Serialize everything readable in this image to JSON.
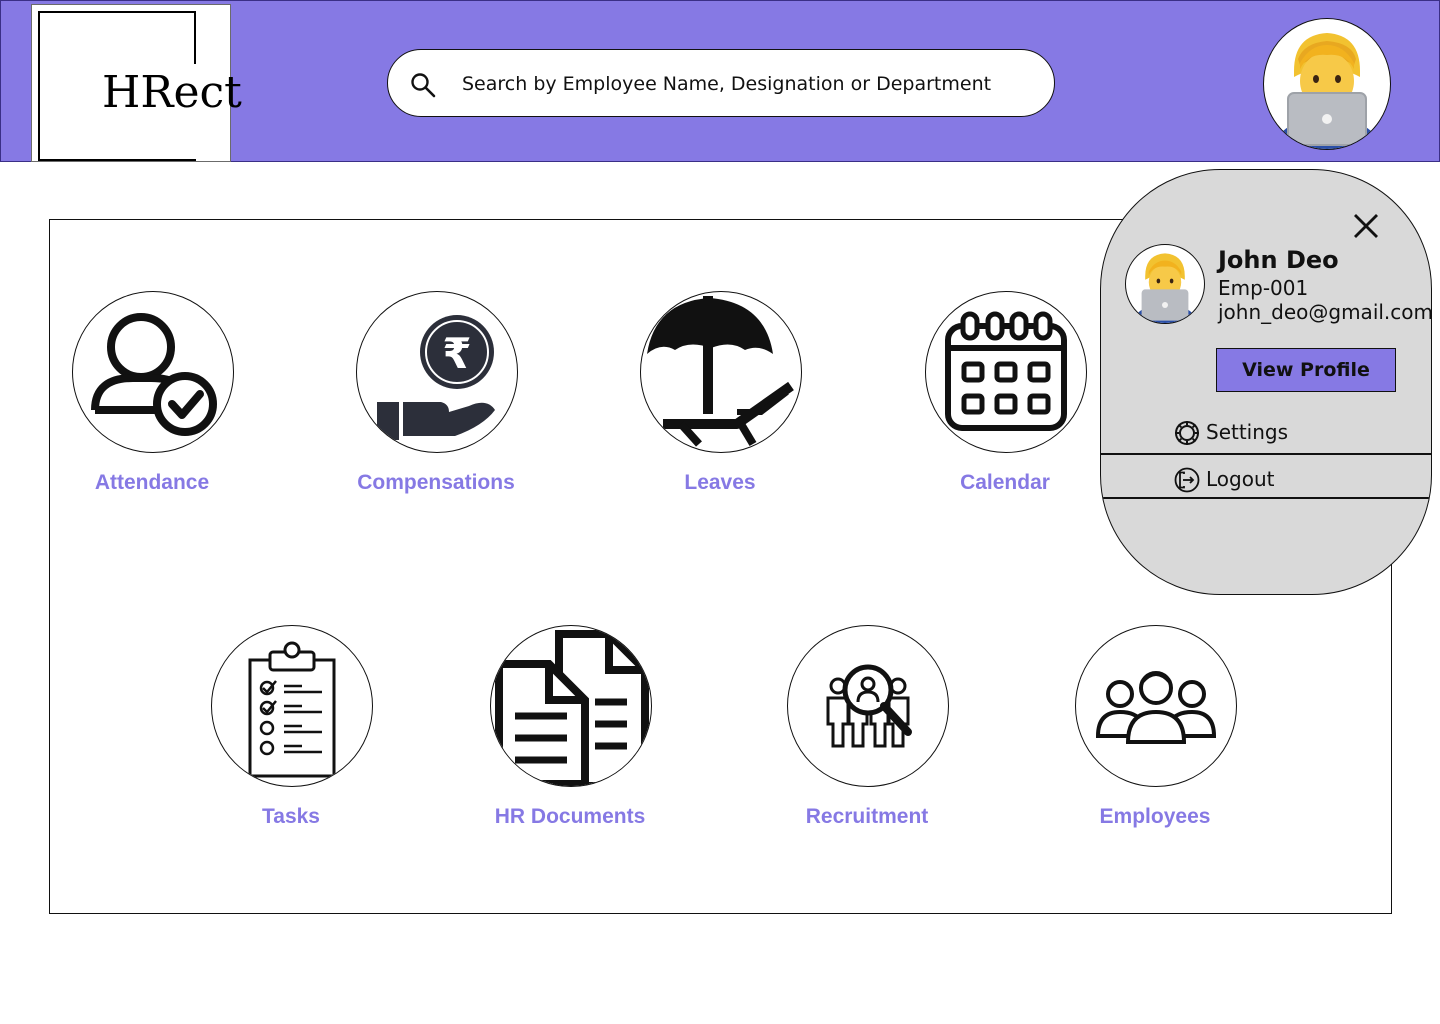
{
  "header": {
    "logo_text": "HRect",
    "search": {
      "placeholder": "Search by Employee Name, Designation or Department",
      "value": ""
    },
    "avatar_icon": "man-technologist-emoji"
  },
  "tiles": [
    {
      "label": "Attendance",
      "icon": "person-check-icon"
    },
    {
      "label": "Compensations",
      "icon": "rupee-hand-icon"
    },
    {
      "label": "Leaves",
      "icon": "beach-umbrella-icon"
    },
    {
      "label": "Calendar",
      "icon": "calendar-icon"
    },
    {
      "label": "Tasks",
      "icon": "checklist-clipboard-icon"
    },
    {
      "label": "HR Documents",
      "icon": "documents-icon"
    },
    {
      "label": "Recruitment",
      "icon": "recruitment-search-icon"
    },
    {
      "label": "Employees",
      "icon": "employees-group-icon"
    }
  ],
  "profile_menu": {
    "name": "John Deo",
    "emp_id": "Emp-001",
    "email": "john_deo@gmail.com",
    "view_profile_label": "View Profile",
    "items": [
      {
        "label": "Settings",
        "icon": "gear-icon"
      },
      {
        "label": "Logout",
        "icon": "logout-icon"
      }
    ]
  },
  "colors": {
    "accent": "#8679e4",
    "popup_bg": "#d9d9d9",
    "text": "#111111"
  }
}
